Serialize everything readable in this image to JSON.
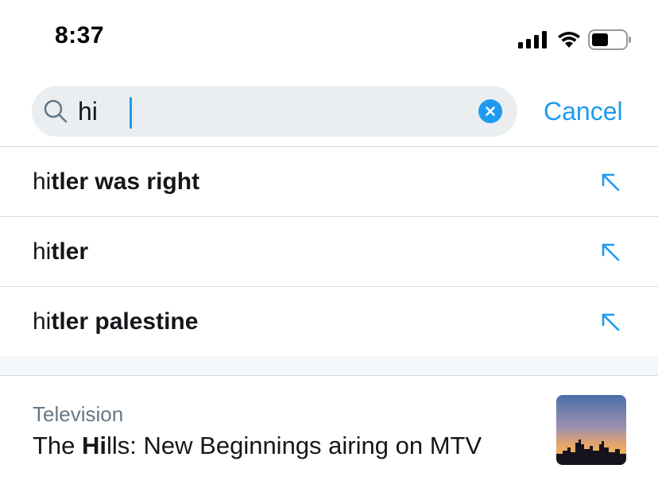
{
  "status_bar": {
    "time": "8:37"
  },
  "search": {
    "query": "hi",
    "cancel_label": "Cancel"
  },
  "suggestions": [
    {
      "typed": "hi",
      "rest": "tler was right"
    },
    {
      "typed": "hi",
      "rest": "tler"
    },
    {
      "typed": "hi",
      "rest": "tler palestine"
    }
  ],
  "trend": {
    "category": "Television",
    "title_pre": "The ",
    "title_bold": "Hi",
    "title_post": "lls: New Beginnings airing on MTV"
  },
  "colors": {
    "accent": "#1d9bf0",
    "secondary_text": "#657786",
    "field_bg": "#ebeef0"
  }
}
